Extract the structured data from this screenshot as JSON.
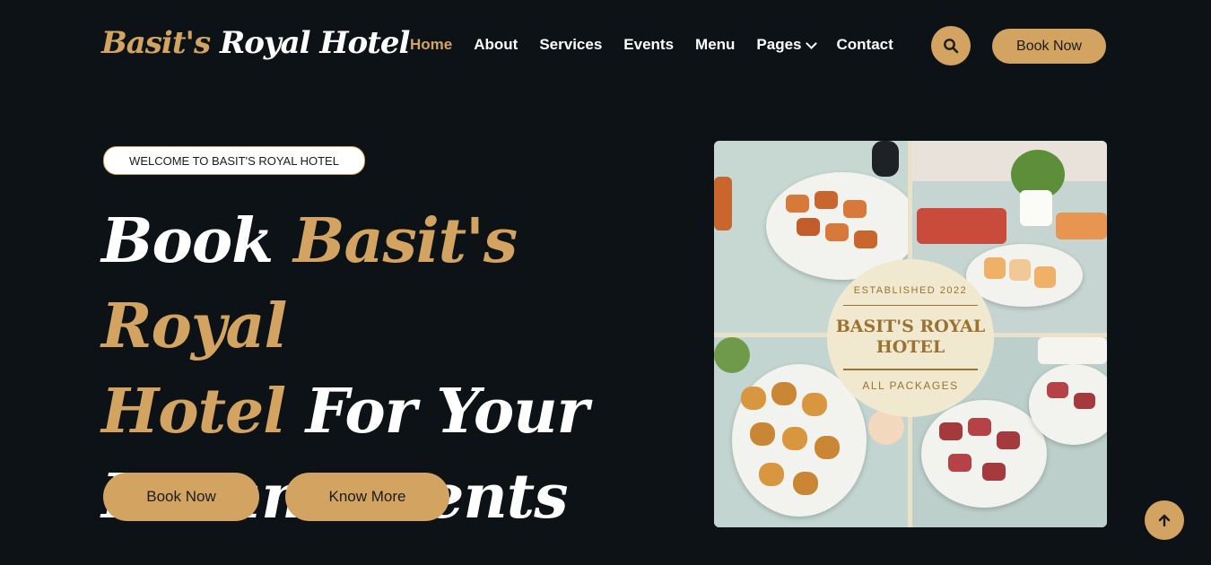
{
  "logo": {
    "part1": "Basit's",
    "part2": "Royal Hotel"
  },
  "nav": {
    "items": [
      {
        "label": "Home"
      },
      {
        "label": "About"
      },
      {
        "label": "Services"
      },
      {
        "label": "Events"
      },
      {
        "label": "Menu"
      },
      {
        "label": "Pages"
      },
      {
        "label": "Contact"
      }
    ],
    "active": "Home",
    "book_label": "Book Now"
  },
  "hero": {
    "badge": "WELCOME TO BASIT'S ROYAL HOTEL",
    "title_w1": "Book",
    "title_w2": "Basit's Royal",
    "title_w3": "Hotel",
    "title_w4": "For Your",
    "title_w5": "Dream Events",
    "book_label": "Book Now",
    "know_label": "Know More"
  },
  "image": {
    "seal_top": "ESTABLISHED 2022",
    "seal_name": "BASIT'S ROYAL HOTEL",
    "seal_bottom": "ALL PACKAGES"
  },
  "icons": {
    "search": "search-icon",
    "chevron": "chevron-down-icon",
    "back_to_top": "arrow-up-icon"
  },
  "colors": {
    "accent": "#d3a461",
    "background": "#0d1216",
    "text": "#ffffff"
  }
}
